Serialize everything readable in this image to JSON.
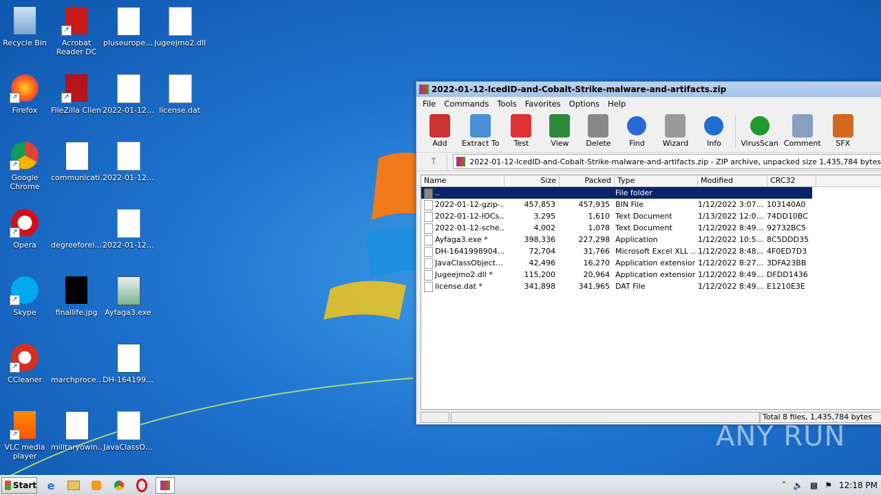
{
  "desktop": {
    "icons": [
      {
        "label": "Recycle Bin",
        "label2": ""
      },
      {
        "label": "Acrobat",
        "label2": "Reader DC"
      },
      {
        "label": "pluseurope…",
        "label2": ""
      },
      {
        "label": "Jugeejmo2.dll",
        "label2": ""
      },
      {
        "label": "Firefox",
        "label2": ""
      },
      {
        "label": "FileZilla Client",
        "label2": ""
      },
      {
        "label": "2022-01-12…",
        "label2": ""
      },
      {
        "label": "license.dat",
        "label2": ""
      },
      {
        "label": "Google",
        "label2": "Chrome"
      },
      {
        "label": "communicati…",
        "label2": ""
      },
      {
        "label": "2022-01-12…",
        "label2": ""
      },
      {
        "label": "Opera",
        "label2": ""
      },
      {
        "label": "degreeforei…",
        "label2": ""
      },
      {
        "label": "2022-01-12…",
        "label2": ""
      },
      {
        "label": "Skype",
        "label2": ""
      },
      {
        "label": "finallife.jpg",
        "label2": ""
      },
      {
        "label": "Ayfaga3.exe",
        "label2": ""
      },
      {
        "label": "CCleaner",
        "label2": ""
      },
      {
        "label": "marchproce…",
        "label2": ""
      },
      {
        "label": "DH-164199…",
        "label2": ""
      },
      {
        "label": "VLC media",
        "label2": "player"
      },
      {
        "label": "militaryowin…",
        "label2": ""
      },
      {
        "label": "JavaClassO…",
        "label2": ""
      }
    ]
  },
  "window": {
    "title": "2022-01-12-IcedID-and-Cobalt-Strike-malware-and-artifacts.zip",
    "menu": [
      "File",
      "Commands",
      "Tools",
      "Favorites",
      "Options",
      "Help"
    ],
    "toolbar": [
      "Add",
      "Extract To",
      "Test",
      "View",
      "Delete",
      "Find",
      "Wizard",
      "Info",
      "VirusScan",
      "Comment",
      "SFX"
    ],
    "path": "2022-01-12-IcedID-and-Cobalt-Strike-malware-and-artifacts.zip - ZIP archive, unpacked size 1,435,784 bytes",
    "columns": [
      "Name",
      "Size",
      "Packed",
      "Type",
      "Modified",
      "CRC32"
    ],
    "rows": [
      {
        "name": "..",
        "size": "",
        "packed": "",
        "type": "File folder",
        "modified": "",
        "crc": ""
      },
      {
        "name": "2022-01-12-gzip-…",
        "size": "457,853",
        "packed": "457,935",
        "type": "BIN File",
        "modified": "1/12/2022 3:07…",
        "crc": "103140A0"
      },
      {
        "name": "2022-01-12-IOCs…",
        "size": "3,295",
        "packed": "1,610",
        "type": "Text Document",
        "modified": "1/13/2022 12:0…",
        "crc": "74DD10BC"
      },
      {
        "name": "2022-01-12-sche…",
        "size": "4,002",
        "packed": "1,078",
        "type": "Text Document",
        "modified": "1/12/2022 8:49…",
        "crc": "92732BC5"
      },
      {
        "name": "Ayfaga3.exe *",
        "size": "398,336",
        "packed": "227,298",
        "type": "Application",
        "modified": "1/12/2022 10:5…",
        "crc": "8C5DDD35"
      },
      {
        "name": "DH-1641998904.…",
        "size": "72,704",
        "packed": "31,766",
        "type": "Microsoft Excel XLL …",
        "modified": "1/12/2022 8:48…",
        "crc": "4F0ED7D3"
      },
      {
        "name": "JavaClassObject…",
        "size": "42,496",
        "packed": "16,270",
        "type": "Application extension",
        "modified": "1/12/2022 8:27…",
        "crc": "3DFA23BB"
      },
      {
        "name": "Jugeejmo2.dll *",
        "size": "115,200",
        "packed": "20,964",
        "type": "Application extension",
        "modified": "1/12/2022 8:49…",
        "crc": "DFDD1436"
      },
      {
        "name": "license.dat *",
        "size": "341,898",
        "packed": "341,965",
        "type": "DAT File",
        "modified": "1/12/2022 8:49…",
        "crc": "E1210E3E"
      }
    ],
    "status": "Total 8 files, 1,435,784 bytes"
  },
  "taskbar": {
    "start_label": "Start",
    "clock": "12:18 PM"
  },
  "watermark": "ANY RUN"
}
